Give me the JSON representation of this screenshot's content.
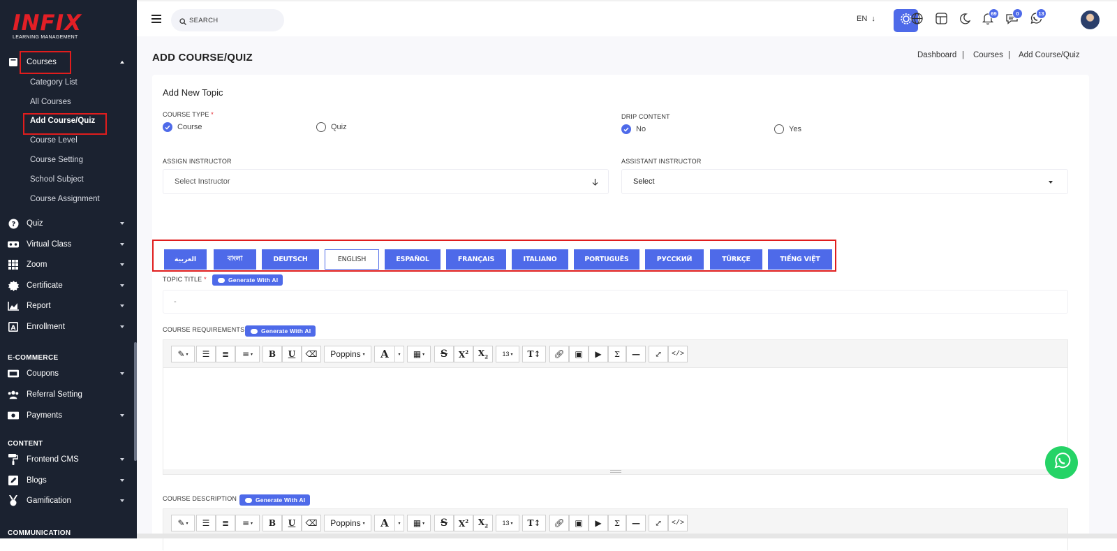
{
  "sidebar": {
    "logo_brand": "INFIX",
    "logo_sub": "LEARNING MANAGEMENT",
    "courses_label": "Courses",
    "sub_items": [
      "Category List",
      "All Courses",
      "Add Course/Quiz",
      "Course Level",
      "Course Setting",
      "School Subject",
      "Course Assignment"
    ],
    "menu": [
      {
        "label": "Quiz",
        "icon": "question-icon"
      },
      {
        "label": "Virtual Class",
        "icon": "vr-icon"
      },
      {
        "label": "Zoom",
        "icon": "grid-icon"
      },
      {
        "label": "Certificate",
        "icon": "certificate-icon"
      },
      {
        "label": "Report",
        "icon": "chart-icon"
      },
      {
        "label": "Enrollment",
        "icon": "enrollment-icon"
      }
    ],
    "section_ecommerce": "E-COMMERCE",
    "ecommerce": [
      {
        "label": "Coupons",
        "icon": "coupon-icon"
      },
      {
        "label": "Referral Setting",
        "icon": "users-icon"
      },
      {
        "label": "Payments",
        "icon": "money-icon"
      }
    ],
    "section_content": "CONTENT",
    "content": [
      {
        "label": "Frontend CMS",
        "icon": "paint-roller-icon"
      },
      {
        "label": "Blogs",
        "icon": "edit-icon"
      },
      {
        "label": "Gamification",
        "icon": "medal-icon"
      }
    ],
    "section_communication": "COMMUNICATION"
  },
  "topbar": {
    "search_placeholder": "SEARCH",
    "language": "EN",
    "notifications_count": "69",
    "messages_count": "0",
    "whatsapp_count": "13"
  },
  "page": {
    "title": "ADD COURSE/QUIZ",
    "breadcrumb": [
      "Dashboard",
      "Courses",
      "Add Course/Quiz"
    ]
  },
  "form": {
    "card_title": "Add New Topic",
    "course_type_label": "COURSE TYPE",
    "required_mark": "*",
    "course_type_options": [
      "Course",
      "Quiz"
    ],
    "drip_label": "DRIP CONTENT",
    "drip_options": [
      "No",
      "Yes"
    ],
    "assign_instructor_label": "ASSIGN INSTRUCTOR",
    "assign_instructor_value": "Select Instructor",
    "assistant_label": "ASSISTANT INSTRUCTOR",
    "assistant_value": "Select",
    "languages": [
      "العربية",
      "বাংলা",
      "DEUTSCH",
      "ENGLISH",
      "ESPAÑOL",
      "FRANÇAIS",
      "ITALIANO",
      "PORTUGUÊS",
      "РУССКИЙ",
      "TÜRKÇE",
      "TIẾNG VIỆT"
    ],
    "topic_title_label": "TOPIC TITLE",
    "topic_title_value": "-",
    "generate_ai": "Generate With AI",
    "requirements_label": "COURSE REQUIREMENTS",
    "description_label": "COURSE DESCRIPTION"
  },
  "editor": {
    "font_name": "Poppins",
    "font_size": "13"
  },
  "colors": {
    "primary": "#4e6ae9",
    "sidebar": "#1b2230",
    "highlight": "#e01d1d",
    "whatsapp": "#25d366"
  }
}
